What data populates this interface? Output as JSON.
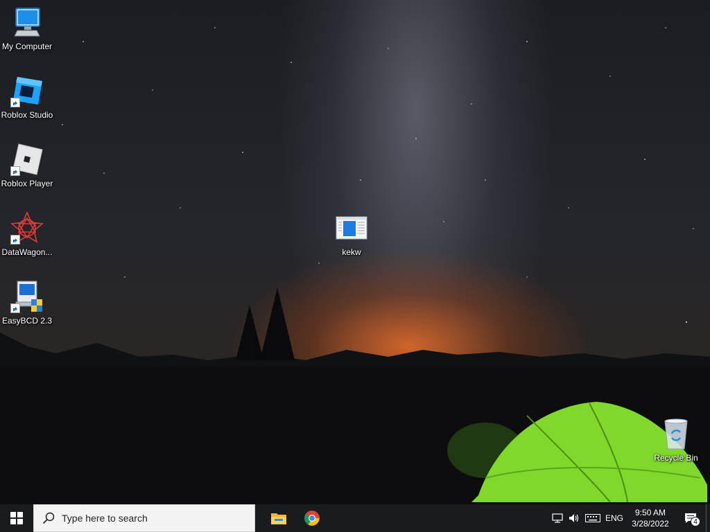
{
  "desktop": {
    "icons": [
      {
        "label": "My Computer",
        "icon": "monitor-icon"
      },
      {
        "label": "Roblox Studio",
        "icon": "roblox-studio-icon"
      },
      {
        "label": "Roblox Player",
        "icon": "roblox-player-icon"
      },
      {
        "label": "DataWagon...",
        "icon": "datawagon-icon"
      },
      {
        "label": "EasyBCD 2.3",
        "icon": "easybcd-icon"
      },
      {
        "label": "kekw",
        "icon": "document-icon"
      },
      {
        "label": "Recycle Bin",
        "icon": "recycle-bin-icon"
      }
    ]
  },
  "taskbar": {
    "search_placeholder": "Type here to search",
    "apps": [
      {
        "name": "File Explorer",
        "icon": "folder-icon"
      },
      {
        "name": "Google Chrome",
        "icon": "chrome-icon"
      }
    ],
    "tray": {
      "language": "ENG",
      "time": "9:50 AM",
      "date": "3/28/2022",
      "notification_count": "4"
    }
  },
  "colors": {
    "taskbar_bg": "#1a1b1f",
    "search_bg": "#f3f3f3",
    "accent_blue": "#1e90ff"
  }
}
